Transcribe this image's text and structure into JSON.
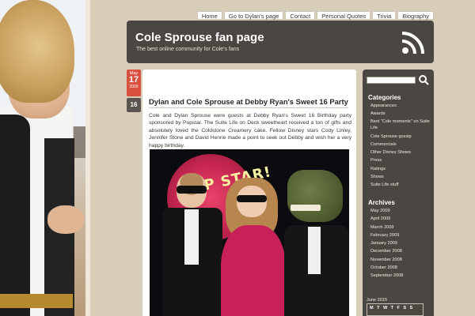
{
  "nav": {
    "items": [
      "Home",
      "Go to Dylan's page",
      "Contact",
      "Personal Quotes",
      "Trivia",
      "Biography"
    ]
  },
  "header": {
    "title": "Cole Sprouse fan page",
    "tagline": "The best online community for Cole's fans",
    "icon": "rss-icon"
  },
  "post": {
    "date": {
      "month": "May",
      "day": "17",
      "year": "2009"
    },
    "comments": "16",
    "title": "Dylan and Cole Sprouse at Debby Ryan's Sweet 16 Party",
    "body": "Cole and Dylan Sprouse were guests at Debby Ryan's Sweet 16 Birthday party sponsored by Popstar. The Suite Life on Deck sweetheart received a ton of gifts and absolutely loved the Coldstone Creamery cake. Fellow Disney stars Cody Linley, Jennifer Stone and David Henrie made a point to seek out Debby and wish her a very happy birthday.",
    "photo_sign": "POP STAR!"
  },
  "sidebar": {
    "search_icon": "search-icon",
    "categories_heading": "Categories",
    "categories": [
      "Appearances",
      "Awards",
      "Best \"Cole moments\" on Suite Life",
      "Cole Sprouse gossip",
      "Commercials",
      "Other Disney Shows",
      "Press",
      "Ratings",
      "Shows",
      "Suite Life stuff"
    ],
    "archives_heading": "Archives",
    "archives": [
      "May 2009",
      "April 2009",
      "March 2009",
      "February 2009",
      "January 2009",
      "December 2008",
      "November 2008",
      "October 2008",
      "September 2008"
    ],
    "calendar": {
      "month": "June 2015",
      "days": [
        "M",
        "T",
        "W",
        "T",
        "F",
        "S",
        "S"
      ]
    }
  },
  "colors": {
    "background": "#d7cdb9",
    "panel": "#4a4642",
    "accent": "#d9503f"
  }
}
